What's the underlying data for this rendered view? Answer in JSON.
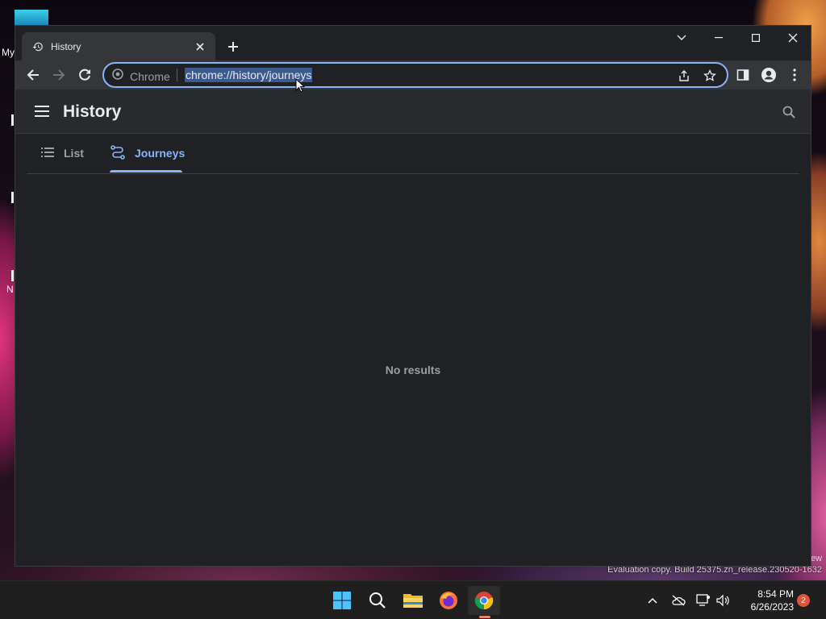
{
  "desktop": {
    "left_fragments": [
      "My",
      "N"
    ],
    "evaluation_text": "Evaluation copy. Build 25375.zn_release.230520-1632",
    "ew_text": "ew"
  },
  "browser": {
    "tab": {
      "title": "History"
    },
    "omnibox": {
      "chip_label": "Chrome",
      "url": "chrome://history/journeys"
    }
  },
  "history_page": {
    "title": "History",
    "tabs": [
      {
        "label": "List",
        "selected": false
      },
      {
        "label": "Journeys",
        "selected": true
      }
    ],
    "empty_message": "No results"
  },
  "taskbar": {
    "apps": [
      "start-icon",
      "search-icon",
      "file-explorer-icon",
      "firefox-icon",
      "chrome-icon"
    ],
    "clock": {
      "time": "8:54 PM",
      "date": "6/26/2023"
    },
    "notification_count": "2"
  },
  "colors": {
    "accent": "#8ab4f8",
    "window_bg": "#202124",
    "toolbar_bg": "#35363a",
    "text_muted": "#9aa0a6"
  }
}
